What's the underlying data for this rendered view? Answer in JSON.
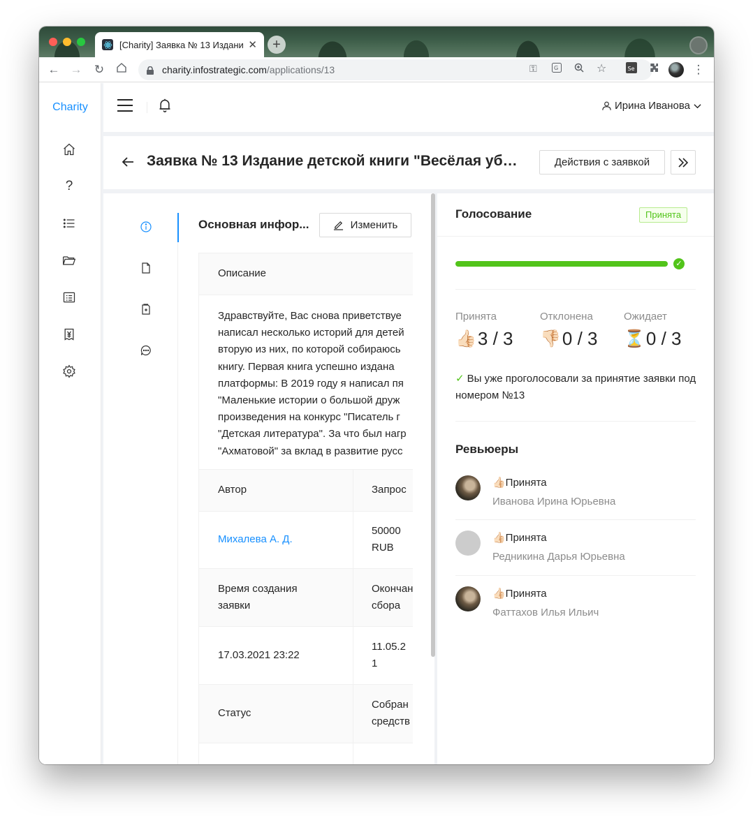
{
  "browser": {
    "tab_title": "[Charity] Заявка № 13 Издани",
    "url_host": "charity.infostrategic.com",
    "url_path": "/applications/13"
  },
  "sidebar": {
    "brand": "Charity",
    "items": [
      {
        "icon": "home-icon"
      },
      {
        "icon": "help-icon"
      },
      {
        "icon": "list-icon"
      },
      {
        "icon": "folder-icon"
      },
      {
        "icon": "profile-icon"
      },
      {
        "icon": "money-icon"
      },
      {
        "icon": "settings-icon"
      }
    ]
  },
  "header": {
    "user_name": "Ирина Иванова"
  },
  "page": {
    "title": "Заявка № 13 Издание детской книги \"Весёлая уб…",
    "actions_button": "Действия с заявкой"
  },
  "info": {
    "section_title": "Основная инфор...",
    "edit_button": "Изменить",
    "description_label": "Описание",
    "description_lines": [
      "Здравствуйте, Вас снова приветствуе",
      "написал несколько историй для детей",
      "вторую из них, по которой собираюсь",
      "книгу. Первая книга успешно издана",
      "платформы: В 2019 году я написал пя",
      "\"Маленькие истории о большой друж",
      "произведения на конкурс \"Писатель г",
      "\"Детская литература\". За что был нагр",
      "\"Ахматовой\" за вклад в развитие русс"
    ],
    "author_label": "Автор",
    "request_label": "Запрос",
    "author_value": "Михалева А. Д.",
    "request_value_1": "50000",
    "request_value_2": "RUB",
    "created_label_1": "Время создания",
    "created_label_2": "заявки",
    "end_label_1": "Окончан",
    "end_label_2": "сбора",
    "created_value": "17.03.2021 23:22",
    "end_value_1": "11.05.2",
    "end_value_2": "1",
    "status_label": "Статус",
    "collected_label_1": "Собран",
    "collected_label_2": "средств"
  },
  "voting": {
    "title": "Голосование",
    "badge": "Принята",
    "progress_fraction": 1.0,
    "stats": [
      {
        "label": "Принята",
        "emoji": "👍🏻",
        "value": "3 / 3"
      },
      {
        "label": "Отклонена",
        "emoji": "👎🏻",
        "value": "0 / 3"
      },
      {
        "label": "Ожидает",
        "emoji": "⏳",
        "value": "0 / 3"
      }
    ],
    "voted_message": "Вы уже проголосовали за принятие заявки под номером №13"
  },
  "reviewers": {
    "title": "Ревьюеры",
    "items": [
      {
        "status": "👍🏻Принята",
        "name": "Иванова Ирина Юрьевна",
        "avatar": "photo"
      },
      {
        "status": "👍🏻Принята",
        "name": "Редникина Дарья Юрьевна",
        "avatar": "placeholder"
      },
      {
        "status": "👍🏻Принята",
        "name": "Фаттахов Илья Ильич",
        "avatar": "photo"
      }
    ]
  }
}
